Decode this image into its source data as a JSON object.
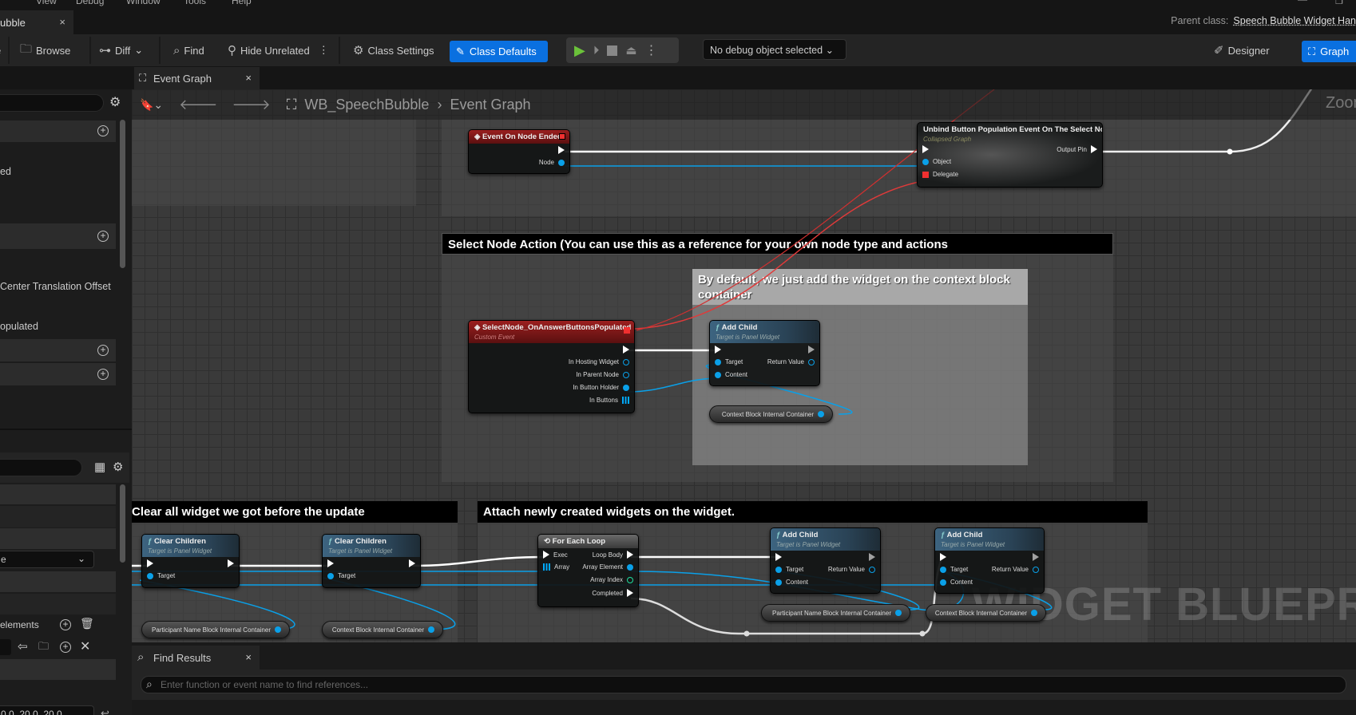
{
  "menu": [
    "t",
    "View",
    "Debug",
    "Window",
    "Tools",
    "Help"
  ],
  "asset_tab": {
    "label": "ubble",
    "close": "×"
  },
  "parent_class": {
    "label": "Parent class:",
    "value": "Speech Bubble Widget Han"
  },
  "toolbar": {
    "browse": "Browse",
    "diff": "Diff",
    "find": "Find",
    "hide_unrelated": "Hide Unrelated",
    "class_settings": "Class Settings",
    "class_defaults": "Class Defaults",
    "debug_object": "No debug object selected",
    "designer": "Designer",
    "graph": "Graph"
  },
  "doc_tab": {
    "label": "Event Graph",
    "close": "×"
  },
  "breadcrumb": {
    "blueprint": "WB_SpeechBubble",
    "separator": "›",
    "graph": "Event Graph"
  },
  "left_panel": {
    "items": [
      "ed",
      "Center Translation Offset",
      "opulated"
    ],
    "dropdown": "e",
    "array_label": "elements",
    "vector_value": "0.0, 20.0, 20.0"
  },
  "graph": {
    "zoom_label": "Zoom",
    "watermark": "WIDGET BLUEPRINT",
    "comments": [
      "Select Node Action (You can use this as a reference for your own node type and actions",
      "By default, we just add the widget on the context block container",
      "Clear all widget we got before the update",
      "Attach newly created widgets on the widget."
    ],
    "nodes": {
      "event_node_ended": {
        "title": "Event On Node Ended",
        "pins": [
          "Node"
        ]
      },
      "unbind": {
        "title": "Unbind Button Population Event On The Select Node",
        "subtitle": "Collapsed Graph",
        "pins": [
          "Output Pin",
          "Object",
          "Delegate"
        ]
      },
      "select_node_event": {
        "title": "SelectNode_OnAnswerButtonsPopulated",
        "subtitle": "Custom Event",
        "pins": [
          "In Hosting Widget",
          "In Parent Node",
          "In Button Holder",
          "In Buttons"
        ]
      },
      "add_child": {
        "title": "Add Child",
        "subtitle": "Target is Panel Widget",
        "pins": [
          "Target",
          "Return Value",
          "Content"
        ]
      },
      "clear_children": {
        "title": "Clear Children",
        "subtitle": "Target is Panel Widget",
        "pins": [
          "Target"
        ]
      },
      "for_each": {
        "title": "For Each Loop",
        "pins": [
          "Exec",
          "Loop Body",
          "Array",
          "Array Element",
          "Array Index",
          "Completed"
        ]
      }
    },
    "variables": {
      "context": "Context Block Internal Container",
      "participant": "Participant Name Block Internal Container"
    }
  },
  "find_results": {
    "tab": "Find Results",
    "close": "×",
    "placeholder": "Enter function or event name to find references..."
  },
  "colors": {
    "accent": "#0a70e0",
    "exec": "#ffffff",
    "object": "#00a8f0",
    "int": "#1fe0a0",
    "delegate": "#f03030",
    "event_header": "#9b1f1f",
    "function_header": "#3d6480"
  }
}
